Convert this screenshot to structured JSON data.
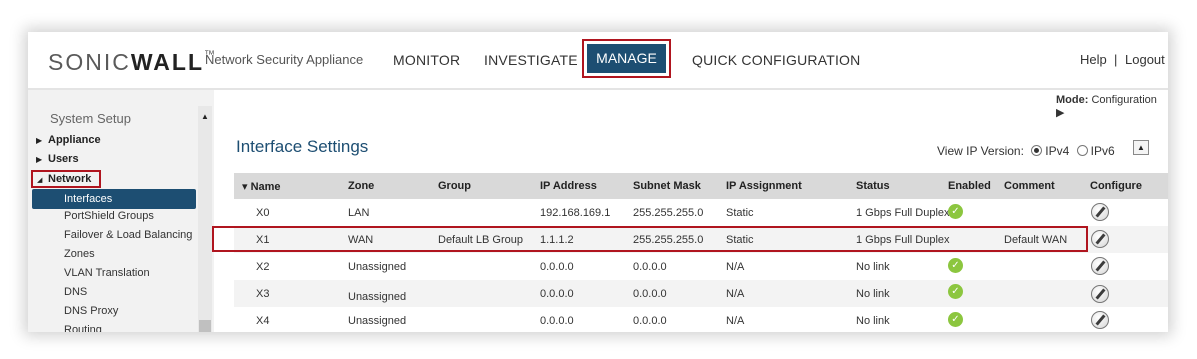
{
  "header": {
    "logo_light": "SONIC",
    "logo_bold": "WALL",
    "logo_tm": "™",
    "product": "Network Security Appliance",
    "nav": {
      "monitor": "MONITOR",
      "investigate": "INVESTIGATE",
      "manage": "MANAGE",
      "quick": "QUICK CONFIGURATION"
    },
    "help": "Help",
    "separator": "|",
    "logout": "Logout"
  },
  "sidebar": {
    "title": "System Setup",
    "groups": {
      "appliance": "Appliance",
      "users": "Users",
      "network": "Network"
    },
    "items": [
      "Interfaces",
      "PortShield Groups",
      "Failover & Load Balancing",
      "Zones",
      "VLAN Translation",
      "DNS",
      "DNS Proxy",
      "Routing"
    ]
  },
  "main": {
    "mode_label": "Mode:",
    "mode_value": "Configuration ▶",
    "title": "Interface Settings",
    "ip_version_label": "View IP Version:",
    "ipv4": "IPv4",
    "ipv6": "IPv6",
    "table": {
      "headers": [
        "▾ Name",
        "Zone",
        "Group",
        "IP Address",
        "Subnet Mask",
        "IP Assignment",
        "Status",
        "Enabled",
        "Comment",
        "Configure"
      ],
      "rows": [
        {
          "name": "X0",
          "zone": "LAN",
          "group": "",
          "ip": "192.168.169.1",
          "mask": "255.255.255.0",
          "assignment": "Static",
          "status": "1 Gbps Full Duplex",
          "enabled": true,
          "comment": ""
        },
        {
          "name": "X1",
          "zone": "WAN",
          "group": "Default LB Group",
          "ip": "1.1.1.2",
          "mask": "255.255.255.0",
          "assignment": "Static",
          "status": "1 Gbps Full Duplex",
          "enabled": false,
          "comment": "Default WAN"
        },
        {
          "name": "X2",
          "zone": "Unassigned",
          "group": "",
          "ip": "0.0.0.0",
          "mask": "0.0.0.0",
          "assignment": "N/A",
          "status": "No link",
          "enabled": true,
          "comment": ""
        },
        {
          "name": "X3",
          "zone": "Unassigned",
          "group": "",
          "ip": "0.0.0.0",
          "mask": "0.0.0.0",
          "assignment": "N/A",
          "status": "No link",
          "enabled": true,
          "comment": ""
        },
        {
          "name": "X4",
          "zone": "Unassigned",
          "group": "",
          "ip": "0.0.0.0",
          "mask": "0.0.0.0",
          "assignment": "N/A",
          "status": "No link",
          "enabled": true,
          "comment": ""
        }
      ]
    }
  },
  "colors": {
    "brand_blue": "#1d4e72",
    "highlight_red": "#b0151f",
    "ok_green": "#8cc63f"
  }
}
